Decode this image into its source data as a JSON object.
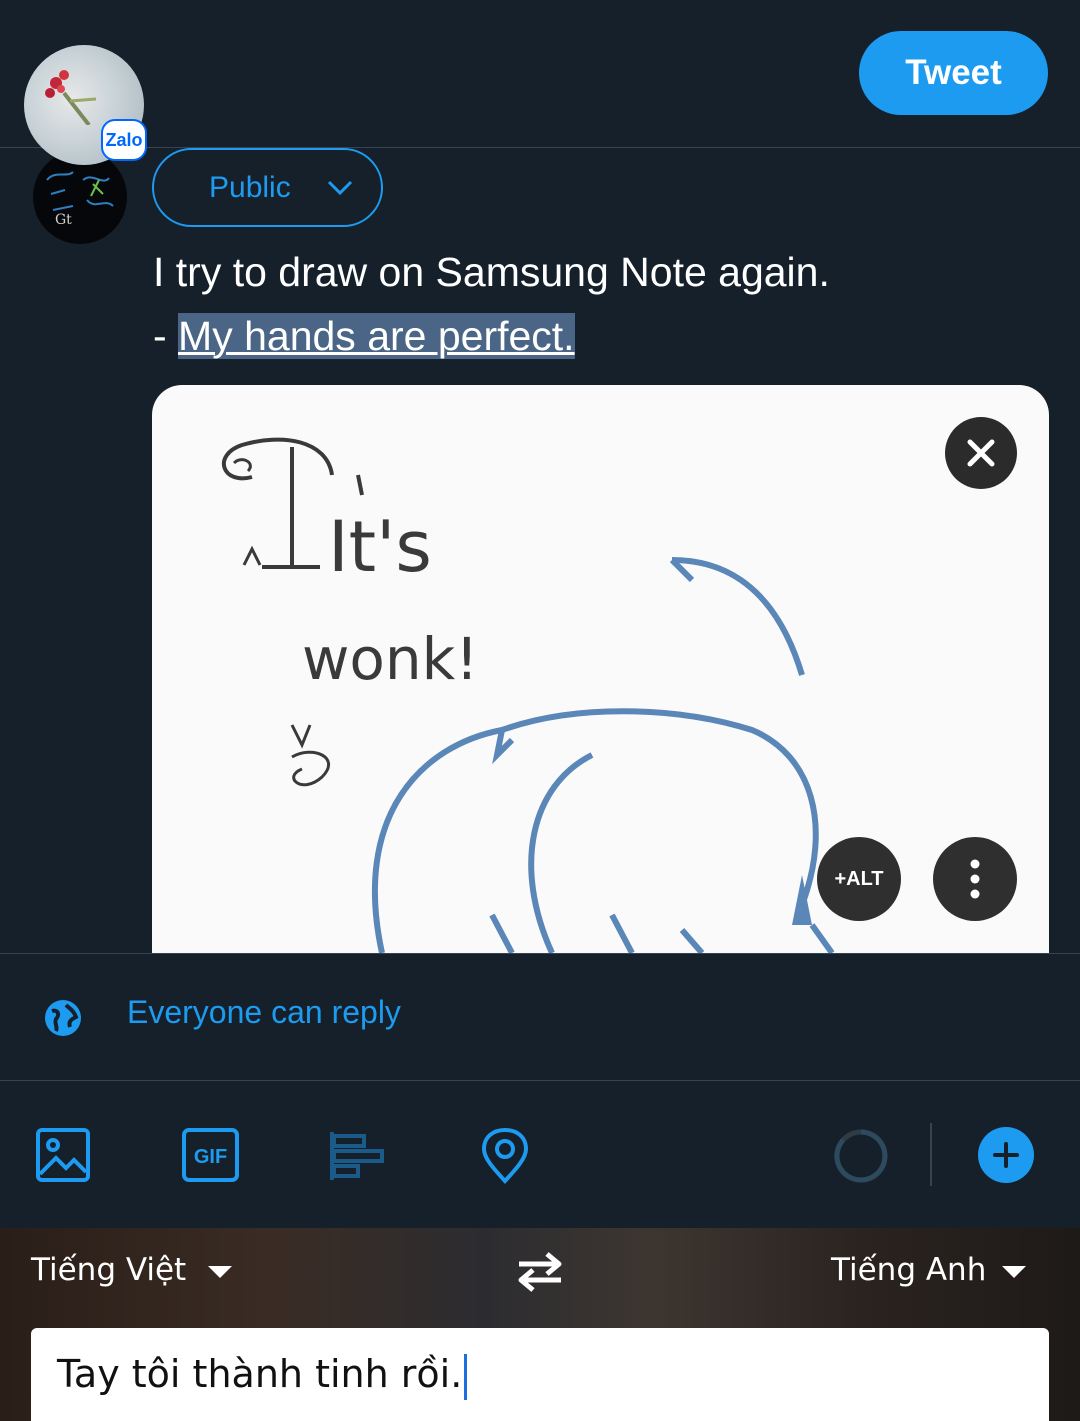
{
  "header": {
    "tweet_button": "Tweet"
  },
  "zalo": {
    "badge": "Zalo"
  },
  "composer": {
    "audience": "Public",
    "text_line1": "I try to draw on Samsung Note again.",
    "text_line2_prefix": "- ",
    "text_line2_selected": "My hands are perfect."
  },
  "media": {
    "drawing_text_1": "It's",
    "drawing_text_2": "wonk!",
    "alt_button": "+ALT"
  },
  "reply_setting": {
    "label": "Everyone can reply"
  },
  "toolbar": {
    "icons": [
      "image-icon",
      "gif-icon",
      "poll-icon",
      "location-icon",
      "char-count-ring",
      "add-thread-icon"
    ],
    "gif_label": "GIF"
  },
  "translate": {
    "source_language": "Tiếng Việt",
    "target_language": "Tiếng Anh",
    "text": "Tay tôi thành tinh rồi."
  },
  "colors": {
    "background": "#15202b",
    "accent": "#1d9bf0",
    "border": "#38444d",
    "selection": "#4a6585"
  }
}
